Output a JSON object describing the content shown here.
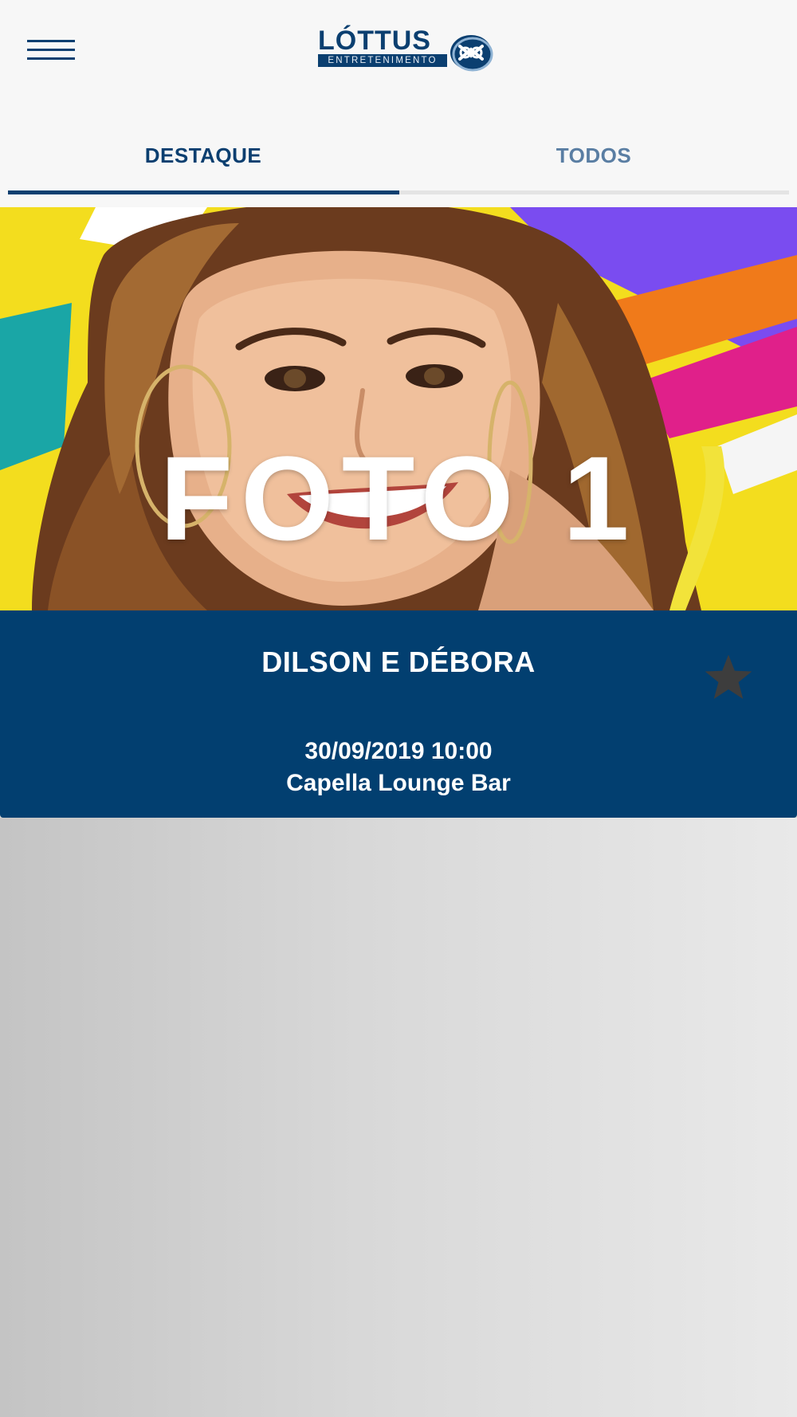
{
  "header": {
    "menu_icon": "hamburger-menu-icon",
    "logo": {
      "word": "LÓTTUS",
      "subtitle": "ENTRETENIMENTO",
      "mark_icon": "lottus-knot-icon"
    }
  },
  "tabs": [
    {
      "label": "DESTAQUE",
      "selected": true
    },
    {
      "label": "TODOS",
      "selected": false
    }
  ],
  "featured_event": {
    "image_text": "FOTO 1",
    "title": "DILSON E DÉBORA",
    "datetime": "30/09/2019 10:00",
    "venue": "Capella Lounge Bar",
    "favorite_icon": "star-icon"
  },
  "colors": {
    "brand_blue": "#023f70",
    "tab_active": "#0b3f70",
    "tab_inactive": "#5a7ea3",
    "star": "#3d3d3d"
  }
}
